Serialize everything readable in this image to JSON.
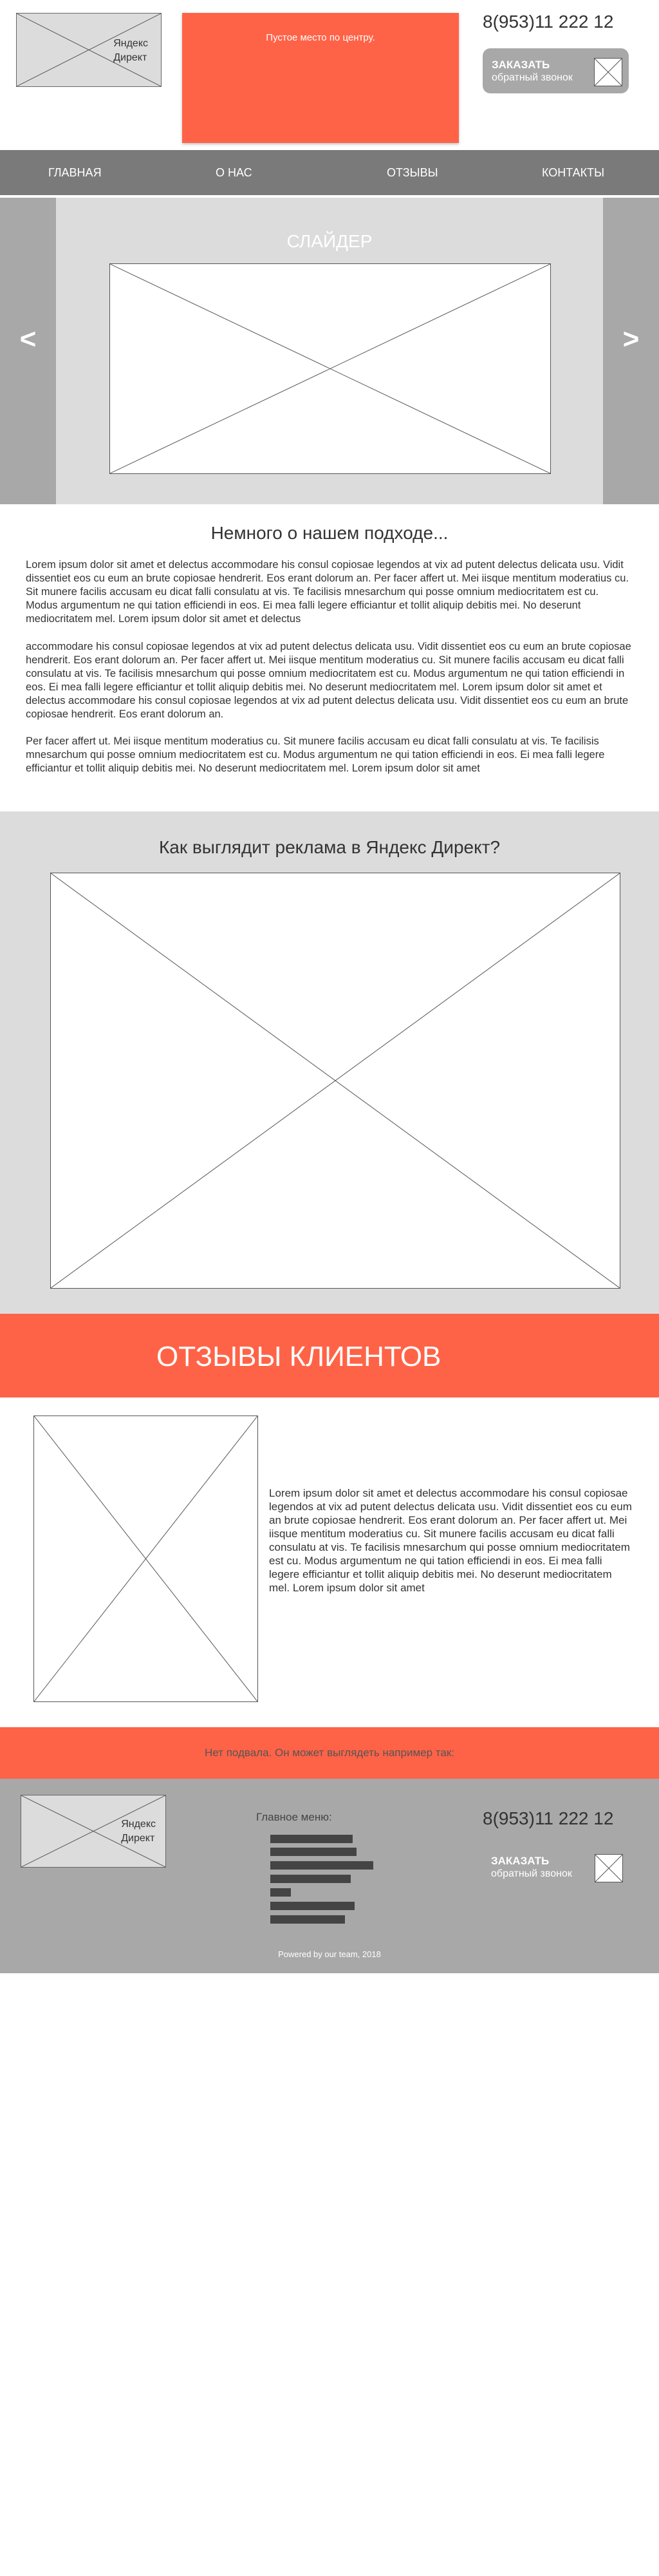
{
  "header": {
    "logo_line1": "Яндекс",
    "logo_line2": "Директ",
    "center_placeholder": "Пустое место по центру.",
    "phone": "8(953)11 222 12",
    "callback_title": "ЗАКАЗАТЬ",
    "callback_sub": "обратный звонок"
  },
  "nav": {
    "items": [
      {
        "label": "ГЛАВНАЯ"
      },
      {
        "label": "О НАС"
      },
      {
        "label": "ОТЗЫВЫ"
      },
      {
        "label": "КОНТАКТЫ"
      }
    ]
  },
  "slider": {
    "title": "СЛАЙДЕР",
    "prev": "<",
    "next": ">"
  },
  "about": {
    "title": "Немного о нашем подходе...",
    "p1": "Lorem ipsum dolor sit amet et delectus accommodare his consul copiosae legendos at vix ad putent delectus delicata usu. Vidit dissentiet eos cu eum an brute copiosae hendrerit. Eos erant dolorum an. Per facer affert ut. Mei iisque mentitum moderatius cu. Sit munere facilis accusam eu dicat falli consulatu at vis. Te facilisis mnesarchum qui posse omnium mediocritatem est cu. Modus argumentum ne qui tation efficiendi in eos. Ei mea falli legere efficiantur et tollit aliquip debitis mei. No deserunt mediocritatem mel. Lorem ipsum dolor sit amet et delectus",
    "p2": "accommodare his consul copiosae legendos at vix ad putent delectus delicata usu. Vidit dissentiet eos cu eum an brute copiosae hendrerit. Eos erant dolorum an. Per facer affert ut. Mei iisque mentitum moderatius cu. Sit munere facilis accusam eu dicat falli consulatu at vis. Te facilisis mnesarchum qui posse omnium mediocritatem est cu. Modus argumentum ne qui tation efficiendi in eos. Ei mea falli legere efficiantur et tollit aliquip debitis mei. No deserunt mediocritatem mel. Lorem ipsum dolor sit amet et delectus accommodare his consul copiosae legendos at vix ad putent delectus delicata usu. Vidit dissentiet eos cu eum an brute copiosae hendrerit. Eos erant dolorum an.",
    "p3": "Per facer affert ut. Mei iisque mentitum moderatius cu. Sit munere facilis accusam eu dicat falli consulatu at vis. Te facilisis mnesarchum qui posse omnium mediocritatem est cu. Modus argumentum ne qui tation efficiendi in eos. Ei mea falli legere efficiantur et tollit aliquip debitis mei. No deserunt mediocritatem mel. Lorem ipsum dolor sit amet"
  },
  "direct": {
    "title": "Как выглядит реклама в Яндекс Директ?"
  },
  "reviews": {
    "title": "ОТЗЫВЫ КЛИЕНТОВ",
    "text": "Lorem ipsum dolor sit amet et delectus accommodare his consul copiosae legendos at vix ad putent delectus delicata usu. Vidit dissentiet eos cu eum an brute copiosae hendrerit. Eos erant dolorum an. Per facer affert ut. Mei iisque mentitum moderatius cu. Sit munere facilis accusam eu dicat falli consulatu at vis. Te facilisis mnesarchum qui posse omnium mediocritatem est cu. Modus argumentum ne qui tation efficiendi in eos. Ei mea falli legere efficiantur et tollit aliquip debitis mei. No deserunt mediocritatem mel. Lorem ipsum dolor sit amet"
  },
  "footer": {
    "note": "Нет подвала. Он может выглядеть например так:",
    "logo_line1": "Яндекс",
    "logo_line2": "Директ",
    "menu_label": "Главное меню:",
    "phone": "8(953)11 222 12",
    "callback_title": "ЗАКАЗАТЬ",
    "callback_sub": "обратный звонок",
    "copyright": "Powered by our team, 2018"
  },
  "colors": {
    "accent": "#ff6347",
    "nav_bg": "#7a7a7a",
    "panel_grey": "#dcdcdc",
    "dark_grey": "#a8a8a8"
  }
}
